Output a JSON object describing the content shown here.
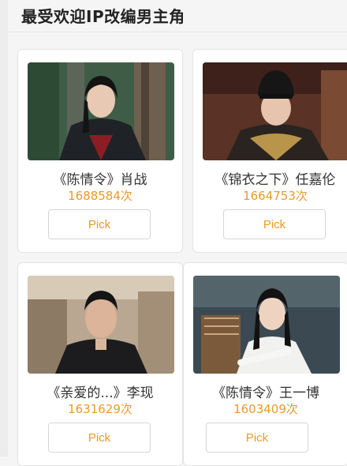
{
  "page": {
    "title": "最受欢迎IP改编男主角"
  },
  "cards": [
    {
      "name": "《陈情令》肖战",
      "votes": "1688584次",
      "button": "Pick"
    },
    {
      "name": "《锦衣之下》任嘉伦",
      "votes": "1664753次",
      "button": "Pick"
    },
    {
      "name": "《亲爱的...》李现",
      "votes": "1631629次",
      "button": "Pick"
    },
    {
      "name": "《陈情令》王一博",
      "votes": "1603409次",
      "button": "Pick"
    }
  ],
  "colors": {
    "accent": "#e89a2c",
    "title": "#222222",
    "card_border": "#e3e3e3"
  }
}
